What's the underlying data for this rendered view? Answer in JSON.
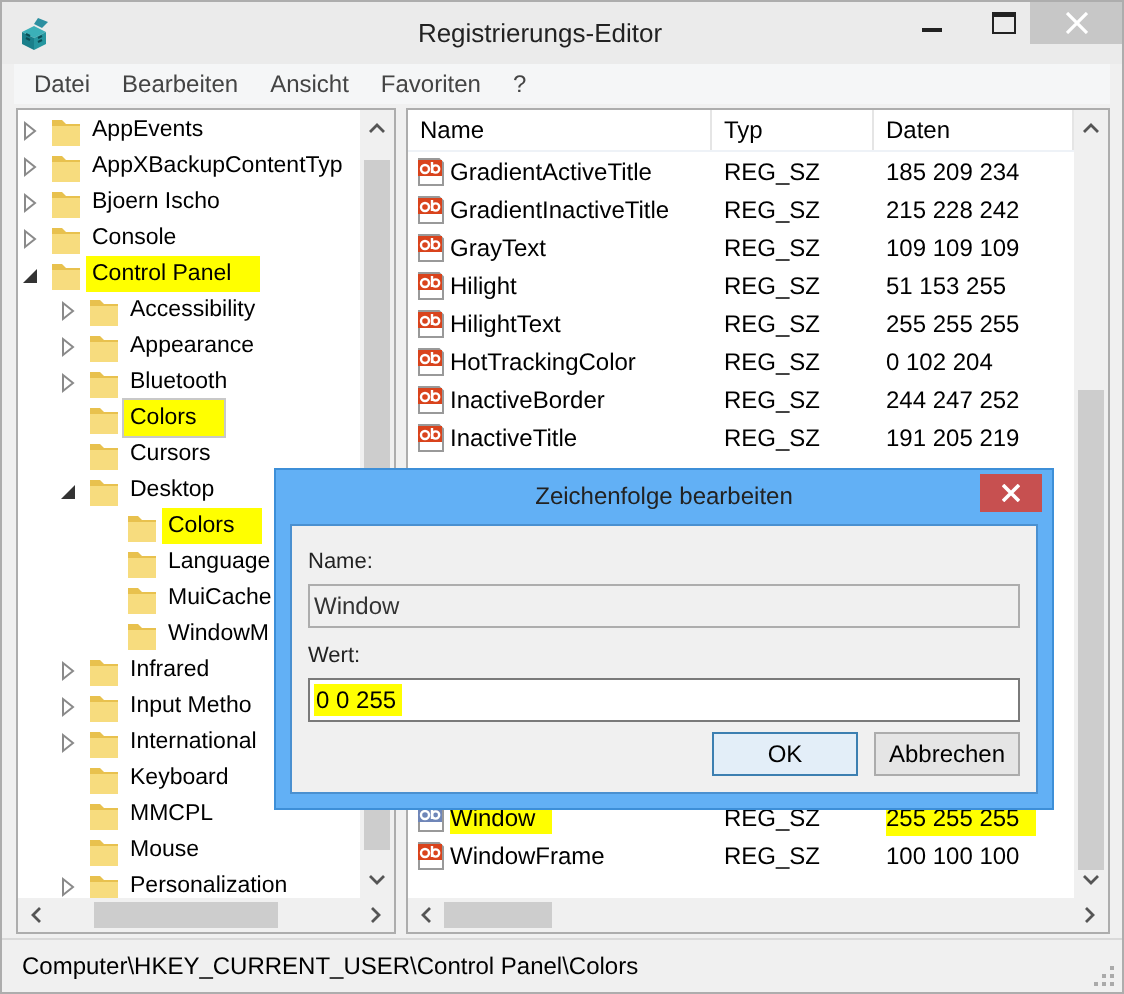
{
  "window": {
    "title": "Registrierungs-Editor"
  },
  "menu": [
    "Datei",
    "Bearbeiten",
    "Ansicht",
    "Favoriten",
    "?"
  ],
  "tree": [
    {
      "label": "AppEvents",
      "expandable": true,
      "expanded": false,
      "selected": false,
      "highlighted": false
    },
    {
      "label": "AppXBackupContentTyp",
      "expandable": true,
      "expanded": false,
      "selected": false,
      "highlighted": false
    },
    {
      "label": "Bjoern Ischo",
      "expandable": true,
      "expanded": false,
      "selected": false,
      "highlighted": false
    },
    {
      "label": "Console",
      "expandable": true,
      "expanded": false,
      "selected": false,
      "highlighted": false
    },
    {
      "label": "Control Panel",
      "expandable": true,
      "expanded": true,
      "selected": false,
      "highlighted": true,
      "children": [
        {
          "label": "Accessibility",
          "expandable": true,
          "expanded": false,
          "selected": false,
          "highlighted": false
        },
        {
          "label": "Appearance",
          "expandable": true,
          "expanded": false,
          "selected": false,
          "highlighted": false
        },
        {
          "label": "Bluetooth",
          "expandable": true,
          "expanded": false,
          "selected": false,
          "highlighted": false
        },
        {
          "label": "Colors",
          "expandable": false,
          "selected": true,
          "highlighted": true
        },
        {
          "label": "Cursors",
          "expandable": false,
          "selected": false,
          "highlighted": false
        },
        {
          "label": "Desktop",
          "expandable": true,
          "expanded": true,
          "selected": false,
          "highlighted": false,
          "children": [
            {
              "label": "Colors",
              "expandable": false,
              "selected": false,
              "highlighted": true
            },
            {
              "label": "Language",
              "expandable": false,
              "selected": false,
              "highlighted": false
            },
            {
              "label": "MuiCache",
              "expandable": false,
              "selected": false,
              "highlighted": false
            },
            {
              "label": "WindowM",
              "expandable": false,
              "selected": false,
              "highlighted": false
            }
          ]
        },
        {
          "label": "Infrared",
          "expandable": true,
          "expanded": false,
          "selected": false,
          "highlighted": false
        },
        {
          "label": "Input Metho",
          "expandable": true,
          "expanded": false,
          "selected": false,
          "highlighted": false
        },
        {
          "label": "International",
          "expandable": true,
          "expanded": false,
          "selected": false,
          "highlighted": false
        },
        {
          "label": "Keyboard",
          "expandable": false,
          "selected": false,
          "highlighted": false
        },
        {
          "label": "MMCPL",
          "expandable": false,
          "selected": false,
          "highlighted": false
        },
        {
          "label": "Mouse",
          "expandable": false,
          "selected": false,
          "highlighted": false
        },
        {
          "label": "Personalization",
          "expandable": true,
          "expanded": false,
          "selected": false,
          "highlighted": false
        }
      ]
    }
  ],
  "table": {
    "columns": [
      "Name",
      "Typ",
      "Daten"
    ],
    "rows": [
      {
        "name": "GradientActiveTitle",
        "type": "REG_SZ",
        "data": "185 209 234",
        "selected": false,
        "highlighted": false
      },
      {
        "name": "GradientInactiveTitle",
        "type": "REG_SZ",
        "data": "215 228 242",
        "selected": false,
        "highlighted": false
      },
      {
        "name": "GrayText",
        "type": "REG_SZ",
        "data": "109 109 109",
        "selected": false,
        "highlighted": false
      },
      {
        "name": "Hilight",
        "type": "REG_SZ",
        "data": "51 153 255",
        "selected": false,
        "highlighted": false
      },
      {
        "name": "HilightText",
        "type": "REG_SZ",
        "data": "255 255 255",
        "selected": false,
        "highlighted": false
      },
      {
        "name": "HotTrackingColor",
        "type": "REG_SZ",
        "data": "0 102 204",
        "selected": false,
        "highlighted": false
      },
      {
        "name": "InactiveBorder",
        "type": "REG_SZ",
        "data": "244 247 252",
        "selected": false,
        "highlighted": false
      },
      {
        "name": "InactiveTitle",
        "type": "REG_SZ",
        "data": "191 205 219",
        "selected": false,
        "highlighted": false
      },
      {
        "name": "Window",
        "type": "REG_SZ",
        "data": "255 255 255",
        "selected": true,
        "highlighted": true
      },
      {
        "name": "WindowFrame",
        "type": "REG_SZ",
        "data": "100 100 100",
        "selected": false,
        "highlighted": false
      }
    ]
  },
  "dialog": {
    "title": "Zeichenfolge bearbeiten",
    "fields": [
      {
        "label": "Name:",
        "value": "Window",
        "disabled": true,
        "highlighted": false
      },
      {
        "label": "Wert:",
        "value": "0 0 255",
        "disabled": false,
        "highlighted": true
      }
    ],
    "buttons": [
      {
        "label": "OK",
        "default": true
      },
      {
        "label": "Abbrechen",
        "default": false
      }
    ]
  },
  "status_bar": "Computer\\HKEY_CURRENT_USER\\Control Panel\\Colors"
}
